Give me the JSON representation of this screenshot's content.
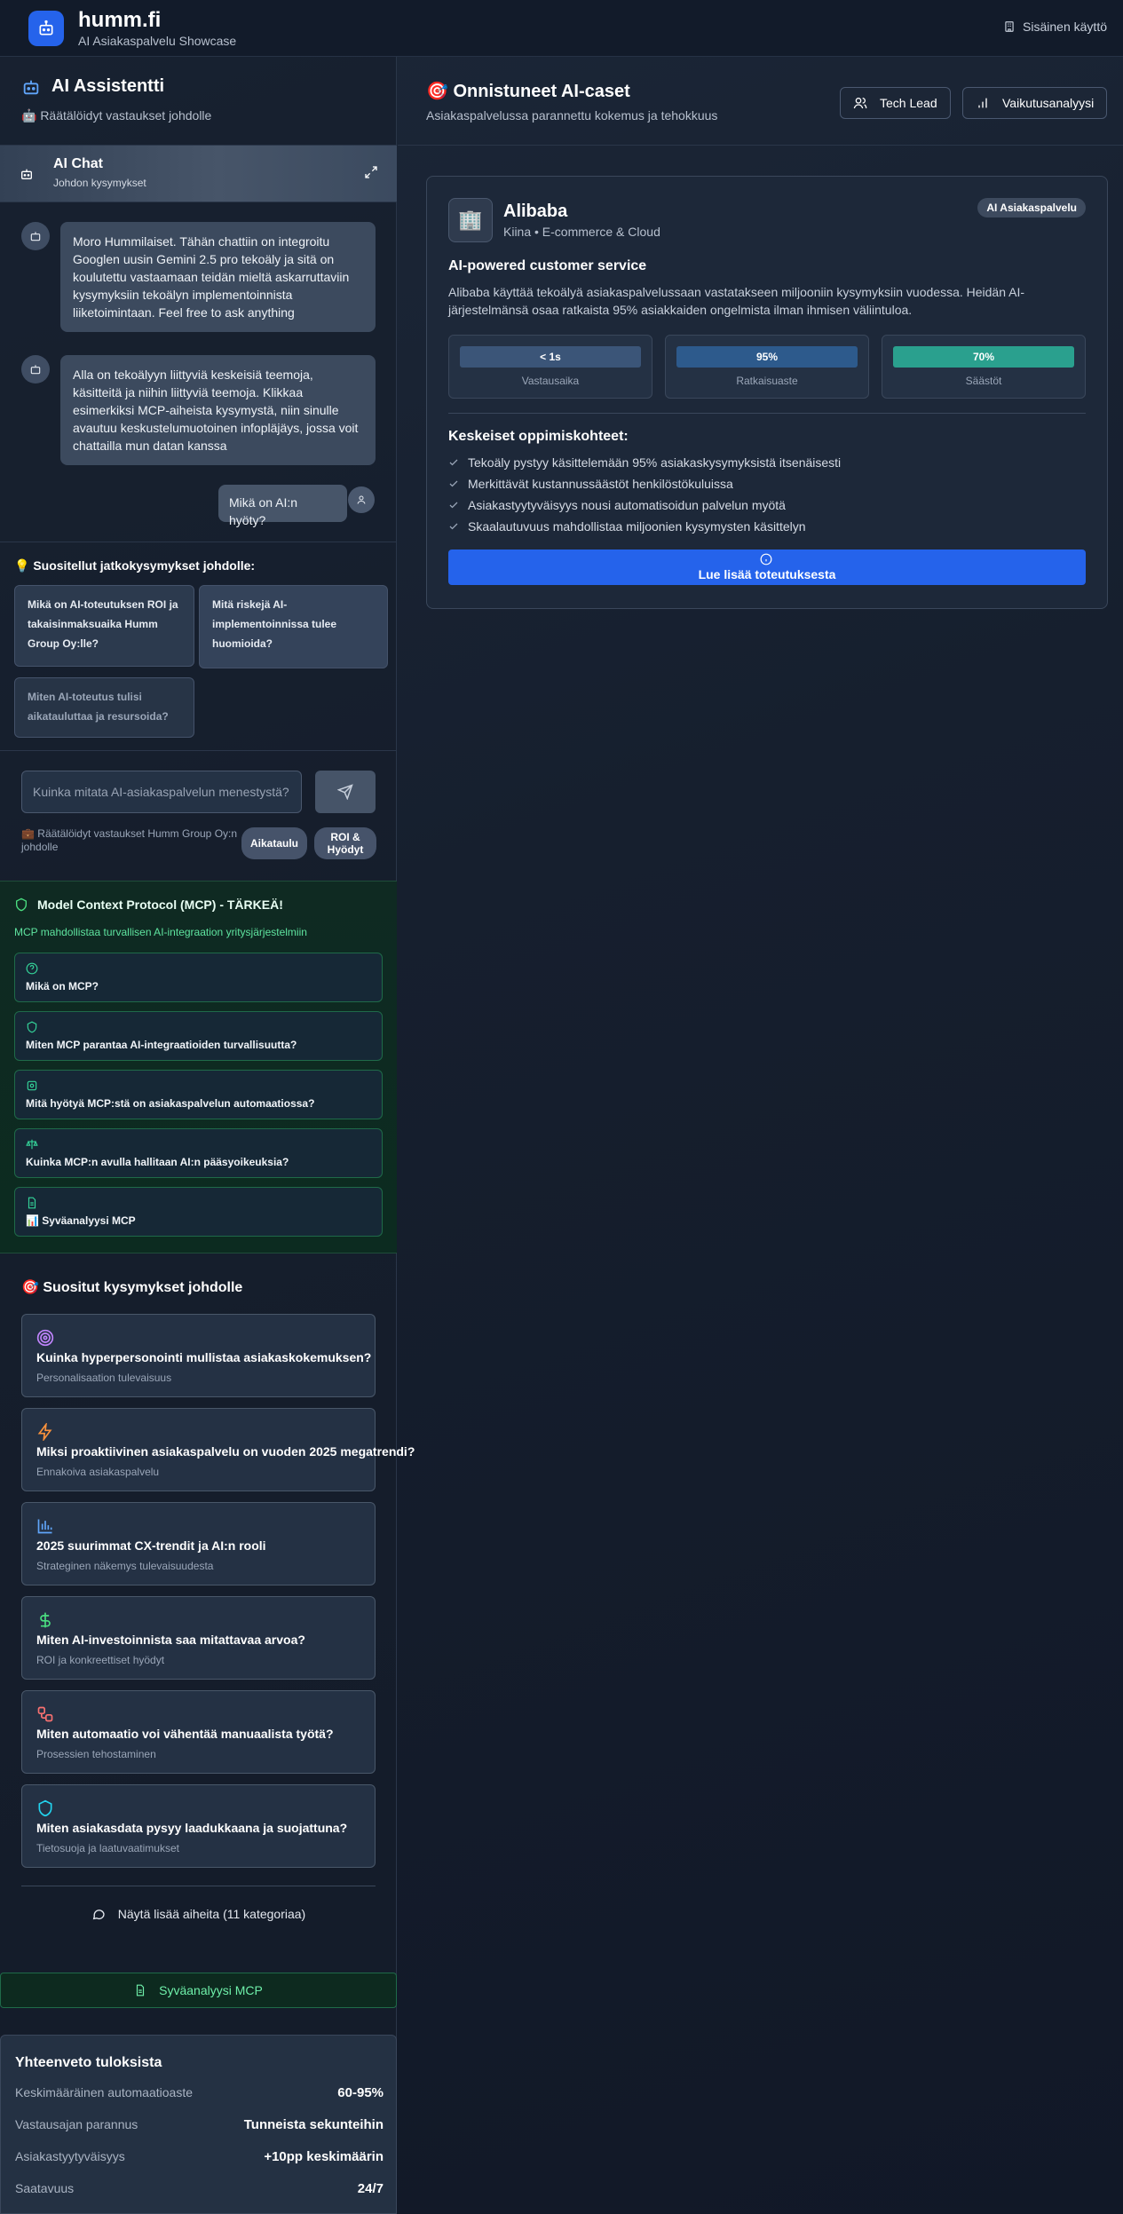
{
  "app": {
    "title": "humm.fi",
    "subtitle": "AI Asiakaspalvelu Showcase",
    "internal_label": "Sisäinen käyttö"
  },
  "assistant": {
    "title": "AI Assistentti",
    "subtitle": "🤖 Räätälöidyt vastaukset johdolle"
  },
  "chat": {
    "title": "AI Chat",
    "subtitle": "Johdon kysymykset",
    "messages": [
      {
        "role": "bot",
        "text": "Moro Hummilaiset. Tähän chattiin on integroitu Googlen uusin Gemini 2.5 pro tekoäly ja sitä on koulutettu vastaamaan teidän mieltä askarruttaviin kysymyksiin tekoälyn implementoinnista liiketoimintaan. Feel free to ask anything"
      },
      {
        "role": "bot",
        "text": "Alla on tekoälyyn liittyviä keskeisiä teemoja, käsitteitä ja niihin liittyviä teemoja. Klikkaa esimerkiksi MCP-aiheista kysymystä, niin sinulle avautuu keskustelumuotoinen infopläjäys, jossa voit chattailla mun datan kanssa"
      },
      {
        "role": "user",
        "text": "Mikä on AI:n hyöty?"
      }
    ]
  },
  "suggestions": {
    "title": "💡 Suositellut jatkokysymykset johdolle:",
    "items": [
      "Mikä on AI-toteutuksen ROI ja takaisinmaksuaika Humm Group Oy:lle?",
      "Mitä riskejä AI-implementoinnissa tulee huomioida?",
      "Miten AI-toteutus tulisi aikatauluttaa ja resursoida?"
    ]
  },
  "input": {
    "placeholder": "Kuinka mitata AI-asiakaspalvelun menestystä?",
    "note": "💼 Räätälöidyt vastaukset Humm Group Oy:n johdolle",
    "chip_schedule": "Aikataulu",
    "chip_roi": "ROI & Hyödyt"
  },
  "mcp": {
    "title": "Model Context Protocol (MCP) - TÄRKEÄ!",
    "subtitle": "MCP mahdollistaa turvallisen AI-integraation yritysjärjestelmiin",
    "items": [
      {
        "label": "Mikä on MCP?",
        "icon": "help-circle-icon"
      },
      {
        "label": "Miten MCP parantaa AI-integraatioiden turvallisuutta?",
        "icon": "shield-icon"
      },
      {
        "label": "Mitä hyötyä MCP:stä on asiakaspalvelun automaatiossa?",
        "icon": "cog-icon"
      },
      {
        "label": "Kuinka MCP:n avulla hallitaan AI:n pääsyoikeuksia?",
        "icon": "scale-icon"
      },
      {
        "label": "📊 Syväanalyysi MCP",
        "icon": "document-icon"
      }
    ]
  },
  "popular": {
    "title": "🎯 Suositut kysymykset johdolle",
    "items": [
      {
        "question": "Kuinka hyperpersonointi mullistaa asiakaskokemuksen?",
        "category": "Personalisaation tulevaisuus",
        "icon": "target-icon",
        "color": "#c084fc"
      },
      {
        "question": "Miksi proaktiivinen asiakaspalvelu on vuoden 2025 megatrendi?",
        "category": "Ennakoiva asiakaspalvelu",
        "icon": "lightning-icon",
        "color": "#fb923c"
      },
      {
        "question": "2025 suurimmat CX-trendit ja AI:n rooli",
        "category": "Strateginen näkemys tulevaisuudesta",
        "icon": "bar-chart-icon",
        "color": "#60a5fa"
      },
      {
        "question": "Miten AI-investoinnista saa mitattavaa arvoa?",
        "category": "ROI ja konkreettiset hyödyt",
        "icon": "dollar-icon",
        "color": "#4ade80"
      },
      {
        "question": "Miten automaatio voi vähentää manuaalista työtä?",
        "category": "Prosessien tehostaminen",
        "icon": "workflow-icon",
        "color": "#f87171"
      },
      {
        "question": "Miten asiakasdata pysyy laadukkaana ja suojattuna?",
        "category": "Tietosuoja ja laatuvaatimukset",
        "icon": "shield-icon",
        "color": "#22d3ee"
      }
    ],
    "more_label": "Näytä lisää aiheita (11 kategoriaa)"
  },
  "deep_analysis_label": "Syväanalyysi MCP",
  "summary": {
    "title": "Yhteenveto tuloksista",
    "rows": [
      {
        "label": "Keskimääräinen automaatioaste",
        "value": "60-95%"
      },
      {
        "label": "Vastausajan parannus",
        "value": "Tunneista sekunteihin"
      },
      {
        "label": "Asiakastyytyväisyys",
        "value": "+10pp keskimäärin"
      },
      {
        "label": "Saatavuus",
        "value": "24/7"
      }
    ]
  },
  "cases": {
    "title": "🎯 Onnistuneet AI-caset",
    "subtitle": "Asiakaspalvelussa parannettu kokemus ja tehokkuus",
    "btn_tech": "Tech Lead",
    "btn_impact": "Vaikutusanalyysi"
  },
  "case": {
    "logo": "🏢",
    "name": "Alibaba",
    "meta": "Kiina • E-commerce & Cloud",
    "tag": "AI Asiakaspalvelu",
    "heading": "AI-powered customer service",
    "description": "Alibaba käyttää tekoälyä asiakaspalvelussaan vastatakseen miljooniin kysymyksiin vuodessa. Heidän AI-järjestelmänsä osaa ratkaista 95% asiakkaiden ongelmista ilman ihmisen väliintuloa.",
    "metrics": [
      {
        "value": "< 1s",
        "label": "Vastausaika",
        "fill": 1.0,
        "color": "#3b5578"
      },
      {
        "value": "95%",
        "label": "Ratkaisuaste",
        "fill": 1.0,
        "color": "#2d5a8c"
      },
      {
        "value": "70%",
        "label": "Säästöt",
        "fill": 1.0,
        "color": "#2aa08e"
      }
    ],
    "learnings_title": "Keskeiset oppimiskohteet:",
    "learnings": [
      "Tekoäly pystyy käsittelemään 95% asiakaskysymyksistä itsenäisesti",
      "Merkittävät kustannussäästöt henkilöstökuluissa",
      "Asiakastyytyväisyys nousi automatisoidun palvelun myötä",
      "Skaalautuvuus mahdollistaa miljoonien kysymysten käsittelyn"
    ],
    "read_more": "Lue lisää toteutuksesta"
  }
}
